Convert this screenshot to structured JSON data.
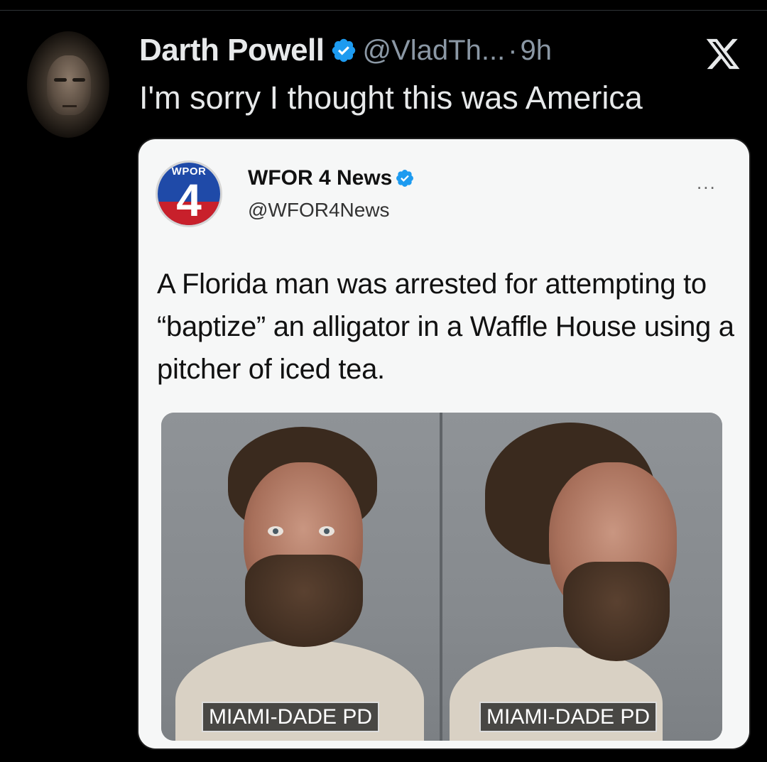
{
  "tweet": {
    "display_name": "Darth Powell",
    "handle": "@VladTh...",
    "separator": "·",
    "time": "9h",
    "text": "I'm sorry I thought this was America",
    "verified_icon": "verified-badge-icon",
    "avatar": "user-avatar",
    "brand_icon": "x-logo-icon"
  },
  "embedded_post": {
    "logo": {
      "tag": "WPOR",
      "number": "4"
    },
    "name": "WFOR 4 News",
    "handle": "@WFOR4News",
    "more_label": "...",
    "text": "A Florida man was arrested for attempting to “baptize” an alligator in a Waffle House using a pitcher of iced tea.",
    "photos": [
      {
        "caption": "MIAMI-DADE PD",
        "view": "front"
      },
      {
        "caption": "MIAMI-DADE PD",
        "view": "profile"
      }
    ]
  },
  "colors": {
    "background": "#000000",
    "primary_text": "#e7e9ea",
    "secondary_text": "#8b98a5",
    "verified_blue": "#1d9bf0",
    "card_background": "#f6f7f7",
    "logo_blue": "#1f4aa8",
    "logo_red": "#c8202b"
  }
}
